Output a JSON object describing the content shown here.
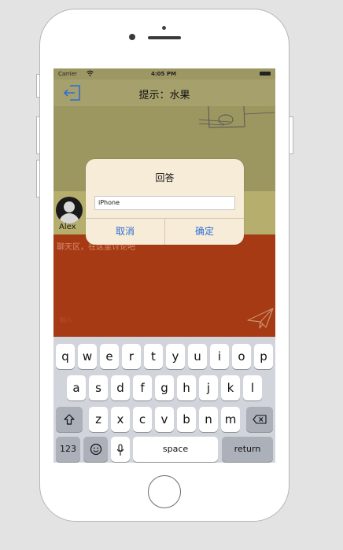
{
  "status_bar": {
    "carrier": "Carrier",
    "time": "4:05 PM"
  },
  "nav": {
    "title": "提示：水果",
    "back_icon": "back-arrow-icon"
  },
  "chat": {
    "avatar_name": "Alex",
    "hint": "聊天区，在这里讨论吧",
    "input_placeholder": "輸入"
  },
  "alert": {
    "title": "回答",
    "input_value": "iPhone",
    "cancel_label": "取消",
    "confirm_label": "确定"
  },
  "keyboard": {
    "row1": [
      "q",
      "w",
      "e",
      "r",
      "t",
      "y",
      "u",
      "i",
      "o",
      "p"
    ],
    "row2": [
      "a",
      "s",
      "d",
      "f",
      "g",
      "h",
      "j",
      "k",
      "l"
    ],
    "row3": [
      "z",
      "x",
      "c",
      "v",
      "b",
      "n",
      "m"
    ],
    "numbers_label": "123",
    "space_label": "space",
    "return_label": "return"
  },
  "colors": {
    "accent": "#2c6fd6",
    "chat_red": "#a63a14",
    "olive": "#9c9660"
  }
}
